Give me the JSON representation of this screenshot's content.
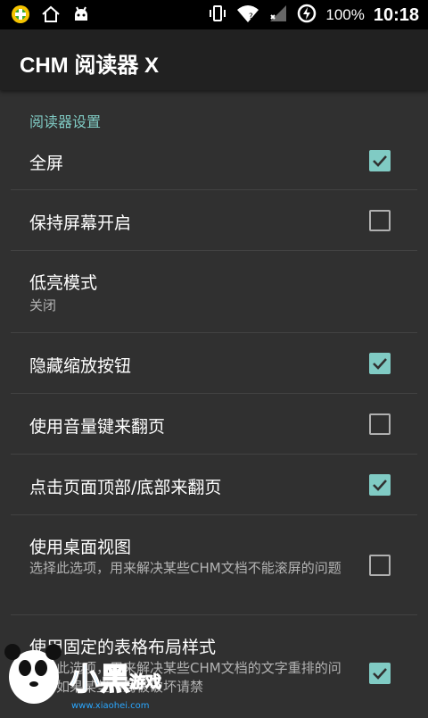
{
  "status_bar": {
    "battery": "100%",
    "time": "10:18"
  },
  "app_bar": {
    "title": "CHM 阅读器 X"
  },
  "section": {
    "header": "阅读器设置"
  },
  "settings": [
    {
      "title": "全屏",
      "summary": "",
      "checked": true
    },
    {
      "title": "保持屏幕开启",
      "summary": "",
      "checked": false
    },
    {
      "title": "低亮模式",
      "summary": "关闭",
      "checked": null
    },
    {
      "title": "隐藏缩放按钮",
      "summary": "",
      "checked": true
    },
    {
      "title": "使用音量键来翻页",
      "summary": "",
      "checked": false
    },
    {
      "title": "点击页面顶部/底部来翻页",
      "summary": "",
      "checked": true
    },
    {
      "title": "使用桌面视图",
      "summary": "选择此选项，用来解决某些CHM文档不能滚屏的问题",
      "checked": false
    },
    {
      "title": "使用固定的表格布局样式",
      "summary": "选择此选项，用来解决某些CHM文档的文字重排的问题，如果某些布局被破坏请禁",
      "checked": true
    }
  ],
  "watermark": {
    "brand": "小黑游戏",
    "url": "www.xiaohei.com"
  },
  "colors": {
    "accent": "#80CBC4",
    "background": "#303030",
    "app_bar": "#212121"
  }
}
